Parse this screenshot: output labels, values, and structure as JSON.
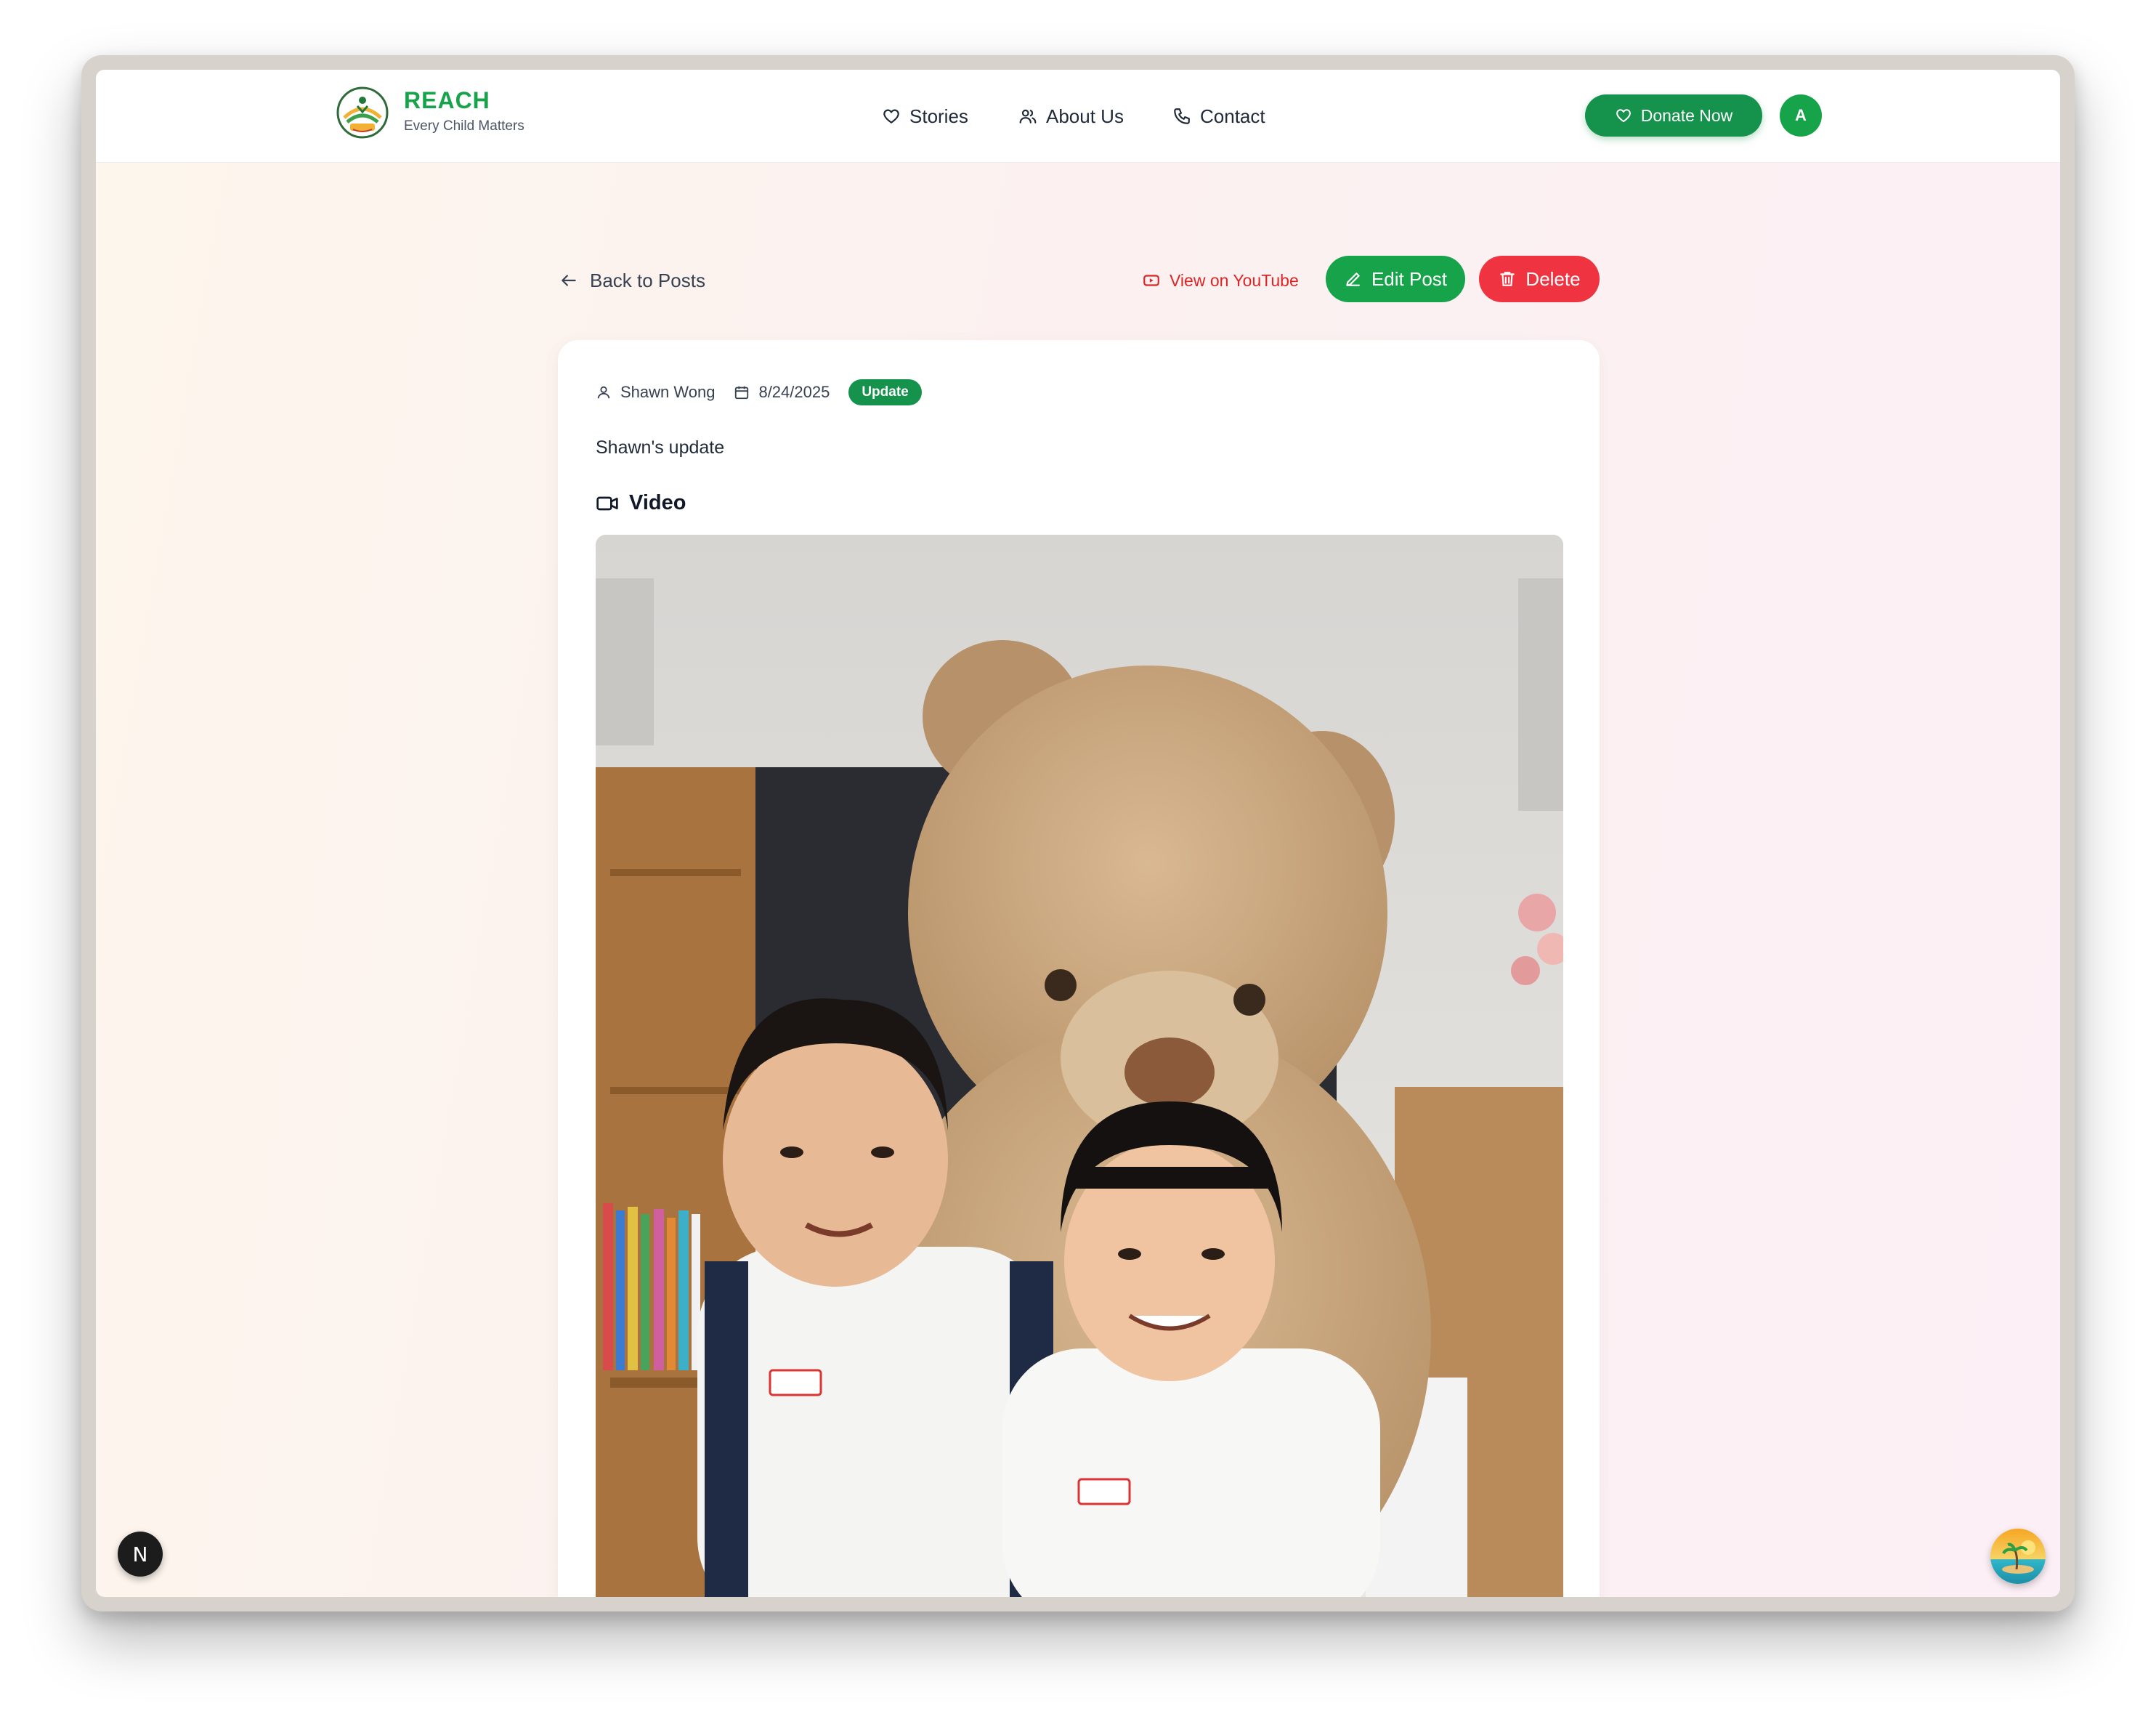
{
  "brand": {
    "name": "REACH",
    "tagline": "Every Child Matters"
  },
  "nav": {
    "items": [
      {
        "label": "Stories",
        "icon": "heart-icon"
      },
      {
        "label": "About Us",
        "icon": "users-icon"
      },
      {
        "label": "Contact",
        "icon": "phone-icon"
      }
    ],
    "donate_label": "Donate Now",
    "avatar_initial": "A"
  },
  "actions": {
    "back_label": "Back to Posts",
    "youtube_label": "View on YouTube",
    "edit_label": "Edit Post",
    "delete_label": "Delete"
  },
  "post": {
    "author": "Shawn Wong",
    "date": "8/24/2025",
    "badge": "Update",
    "description": "Shawn's update",
    "video_heading": "Video"
  },
  "floating": {
    "dev_badge": "N"
  },
  "colors": {
    "primary": "#16a34a",
    "danger": "#ef3340",
    "youtube": "#dc2626"
  }
}
